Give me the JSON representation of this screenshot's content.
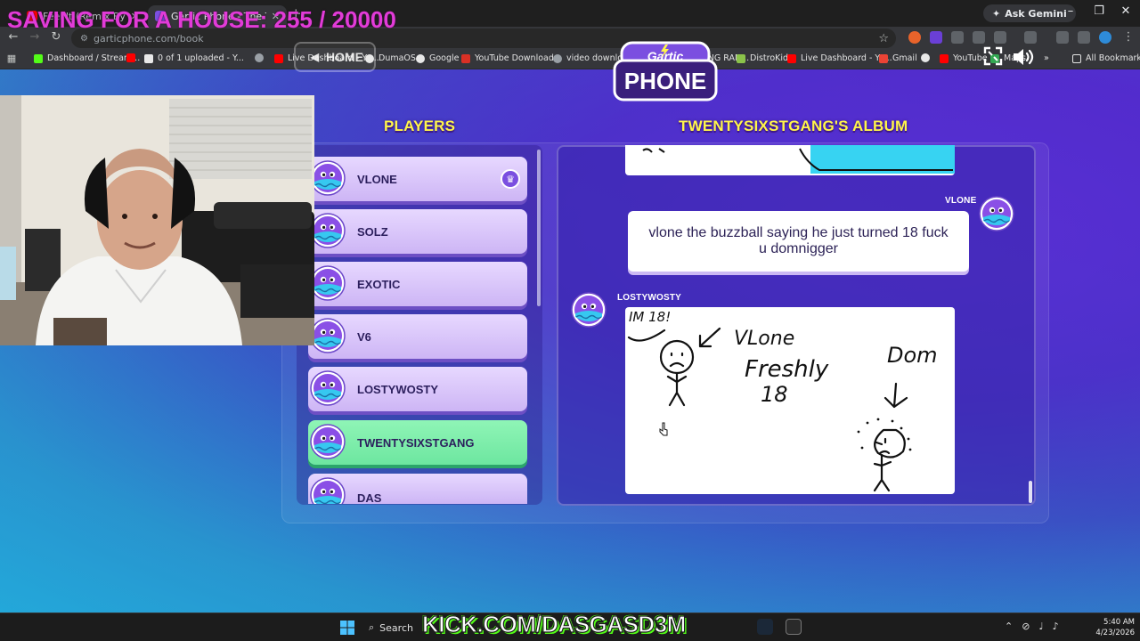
{
  "overlays": {
    "goal_text": "SAVING FOR A HOUSE: 255 / 20000",
    "kick_text": "KICK.COM/DASGASD3M"
  },
  "browser": {
    "tabs": [
      {
        "label": "Feel It (Remix By L...",
        "active": false
      },
      {
        "label": "Gartic Phone - The Teleph...",
        "active": true
      }
    ],
    "new_tab": "+",
    "ask_gemini": "Ask Gemini",
    "url": "garticphone.com/book",
    "bookmarks": [
      "Dashboard / Stream...",
      "0 of 1 uploaded - Y...",
      "Live Dashboard - Yo...",
      "DumaOS",
      "Google",
      "YouTube Download...",
      "video downloader -...",
      "(56) TROLLING RAN...",
      "DistroKid",
      "Live Dashboard - Yo...",
      "Gmail",
      "YouTube",
      "Maps"
    ],
    "all_bookmarks": "All Bookmarks"
  },
  "game": {
    "home_label": "HOME",
    "logo_top": "Gartic",
    "logo_main": "PHONE",
    "players_title": "PLAYERS",
    "album_title": "TWENTYSIXSTGANG'S ALBUM",
    "players": [
      {
        "name": "VLONE",
        "host": true,
        "active": false
      },
      {
        "name": "SOLZ",
        "host": false,
        "active": false
      },
      {
        "name": "EXOTIC",
        "host": false,
        "active": false
      },
      {
        "name": "V6",
        "host": false,
        "active": false
      },
      {
        "name": "LOSTYWOSTY",
        "host": false,
        "active": false
      },
      {
        "name": "TWENTYSIXSTGANG",
        "host": false,
        "active": true
      },
      {
        "name": "DAS",
        "host": false,
        "active": false
      }
    ],
    "album": {
      "text_entry": {
        "author": "VLONE",
        "text": "vlone the buzzball saying he just turned 18 fuck u domnigger"
      },
      "drawing_entry": {
        "author": "LOSTYWOSTY",
        "handwritten_words": [
          "IM 18!",
          "VLone",
          "Freshly",
          "18",
          "Dom"
        ]
      }
    }
  },
  "taskbar": {
    "search_label": "Search",
    "time": "5:40 AM",
    "date": "4/23/2026"
  },
  "colors": {
    "accent_yellow": "#fff54a",
    "player_card": "#ddcbff",
    "player_active": "#7ff0ac",
    "goal_overlay": "#e23bd8",
    "kick_green": "#53fc18"
  }
}
